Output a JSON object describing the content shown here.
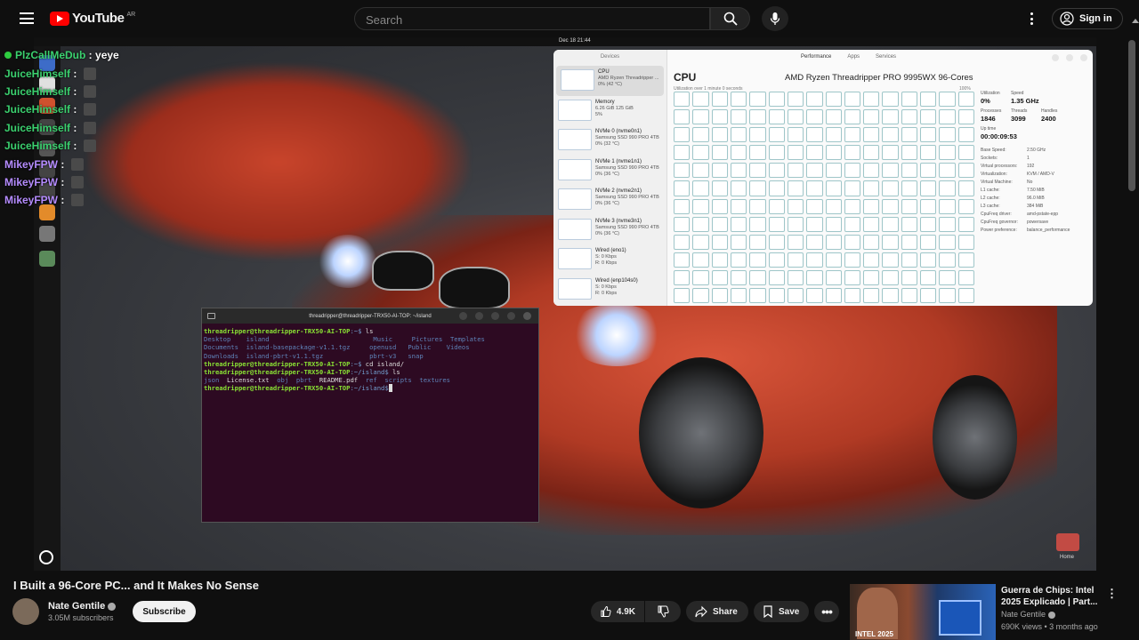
{
  "header": {
    "logo_text": "YouTube",
    "logo_region": "AR",
    "search_placeholder": "Search",
    "signin_label": "Sign in"
  },
  "chat": [
    {
      "user": "PlzCallMeDub",
      "msg": "yeye"
    },
    {
      "user": "JuiceHimself",
      "msg": ""
    },
    {
      "user": "JuiceHimself",
      "msg": ""
    },
    {
      "user": "JuiceHimself",
      "msg": ""
    },
    {
      "user": "JuiceHimself",
      "msg": ""
    },
    {
      "user": "JuiceHimself",
      "msg": ""
    },
    {
      "user": "MikeyFPW",
      "msg": ""
    },
    {
      "user": "MikeyFPW",
      "msg": ""
    },
    {
      "user": "MikeyFPW",
      "msg": ""
    }
  ],
  "desktop": {
    "clock": "Dec 18  21:44",
    "home_label": "Home"
  },
  "sysmon": {
    "side_header": "Devices",
    "tabs": [
      "Performance",
      "Apps",
      "Services"
    ],
    "devices": [
      {
        "name": "CPU",
        "l1": "AMD Ryzen Threadripper ...",
        "l2": "0% (42 °C)"
      },
      {
        "name": "Memory",
        "l1": "6.26 GiB 125 GiB",
        "l2": "5%"
      },
      {
        "name": "NVMe 0 (nvme0n1)",
        "l1": "Samsung SSD 990 PRO 4TB",
        "l2": "0% (32 °C)"
      },
      {
        "name": "NVMe 1 (nvme1n1)",
        "l1": "Samsung SSD 990 PRO 4TB",
        "l2": "0% (36 °C)"
      },
      {
        "name": "NVMe 2 (nvme2n1)",
        "l1": "Samsung SSD 990 PRO 4TB",
        "l2": "0% (36 °C)"
      },
      {
        "name": "NVMe 3 (nvme3n1)",
        "l1": "Samsung SSD 990 PRO 4TB",
        "l2": "0% (36 °C)"
      },
      {
        "name": "Wired (eno1)",
        "l1": "S: 0 Kbps",
        "l2": "R: 0 Kbps"
      },
      {
        "name": "Wired (enp104s0)",
        "l1": "S: 0 Kbps",
        "l2": "R: 0 Kbps"
      }
    ],
    "title": "CPU",
    "model": "AMD Ryzen Threadripper PRO 9995WX 96-Cores",
    "subtitle": "Utilization over 1 minute 0 seconds",
    "max_label": "100%",
    "utilization_label": "Utilization",
    "utilization": "0%",
    "speed_label": "Speed",
    "speed": "1.35 GHz",
    "processes_label": "Processes",
    "processes": "1846",
    "threads_label": "Threads",
    "threads": "3099",
    "handles_label": "Handles",
    "handles": "2400",
    "uptime_label": "Up time",
    "uptime": "00:00:09:53",
    "specs": [
      {
        "k": "Base Speed:",
        "v": "2.50 GHz"
      },
      {
        "k": "Sockets:",
        "v": "1"
      },
      {
        "k": "Virtual processors:",
        "v": "192"
      },
      {
        "k": "Virtualization:",
        "v": "KVM / AMD-V"
      },
      {
        "k": "Virtual Machine:",
        "v": "No"
      },
      {
        "k": "L1 cache:",
        "v": "7.50 MiB"
      },
      {
        "k": "L2 cache:",
        "v": "96.0 MiB"
      },
      {
        "k": "L3 cache:",
        "v": "384 MiB"
      },
      {
        "k": "CpuFreq driver:",
        "v": "amd-pstate-epp"
      },
      {
        "k": "CpuFreq governor:",
        "v": "powersave"
      },
      {
        "k": "Power preference:",
        "v": "balance_performance"
      }
    ]
  },
  "terminal": {
    "title": "threadripper@threadripper-TRX50-AI-TOP: ~/island",
    "prompt": "threadripper@threadripper-TRX50-AI-TOP",
    "path_home": ":~$",
    "path_island": ":~/island$",
    "cmd1": " ls",
    "row1": "Desktop    island                           Music     Pictures  Templates",
    "row2": "Documents  island-basepackage-v1.1.tgz     openusd   Public    Videos",
    "row3": "Downloads  island-pbrt-v1.1.tgz            pbrt-v3   snap",
    "cmd2": " cd island/",
    "cmd3": " ls",
    "row4a": "json  ",
    "row4b": "License.txt",
    "row4c": "  obj  pbrt  ",
    "row4d": "README.pdf",
    "row4e": "  ref  scripts  textures"
  },
  "video": {
    "title": "I Built a 96-Core PC... and It Makes No Sense",
    "channel": "Nate Gentile",
    "subscribers": "3.05M subscribers",
    "subscribe_label": "Subscribe",
    "likes": "4.9K",
    "share_label": "Share",
    "save_label": "Save"
  },
  "related": {
    "title": "Guerra de Chips: Intel 2025 Explicado | Part...",
    "channel": "Nate Gentile",
    "meta": "690K views • 3 months ago",
    "thumb_text": "INTEL 2025"
  },
  "colors": {
    "accent": "#ff0000",
    "chat_name": "#3bd16f",
    "terminal_bg": "#2d0a22"
  }
}
